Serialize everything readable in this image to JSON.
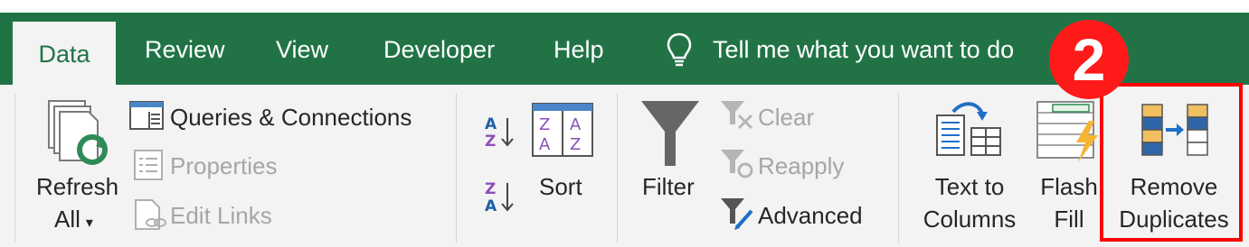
{
  "tabs": [
    {
      "label": "Data",
      "active": true
    },
    {
      "label": "Review",
      "active": false
    },
    {
      "label": "View",
      "active": false
    },
    {
      "label": "Developer",
      "active": false
    },
    {
      "label": "Help",
      "active": false
    }
  ],
  "tell_me": {
    "text": "Tell me what you want to do",
    "icon": "lightbulb-icon"
  },
  "colors": {
    "tab_bar": "#217346",
    "ribbon": "#f3f3f3",
    "highlight": "#ff0000",
    "badge": "#ff1a1a"
  },
  "queries_group": {
    "refresh_line1": "Refresh",
    "refresh_line2": "All",
    "refresh_caret": "▾",
    "queries_connections": "Queries & Connections",
    "properties": "Properties",
    "edit_links": "Edit Links"
  },
  "sort_group": {
    "sort_az": "A→Z",
    "sort_za": "Z→A",
    "sort": "Sort"
  },
  "filter_group": {
    "filter": "Filter",
    "clear": "Clear",
    "reapply": "Reapply",
    "advanced": "Advanced"
  },
  "tools_group": {
    "text_to_line1": "Text to",
    "text_to_line2": "Columns",
    "flash_line1": "Flash",
    "flash_line2": "Fill",
    "remove_line1": "Remove",
    "remove_line2": "Duplicates"
  },
  "annotation": {
    "step_number": "2"
  }
}
